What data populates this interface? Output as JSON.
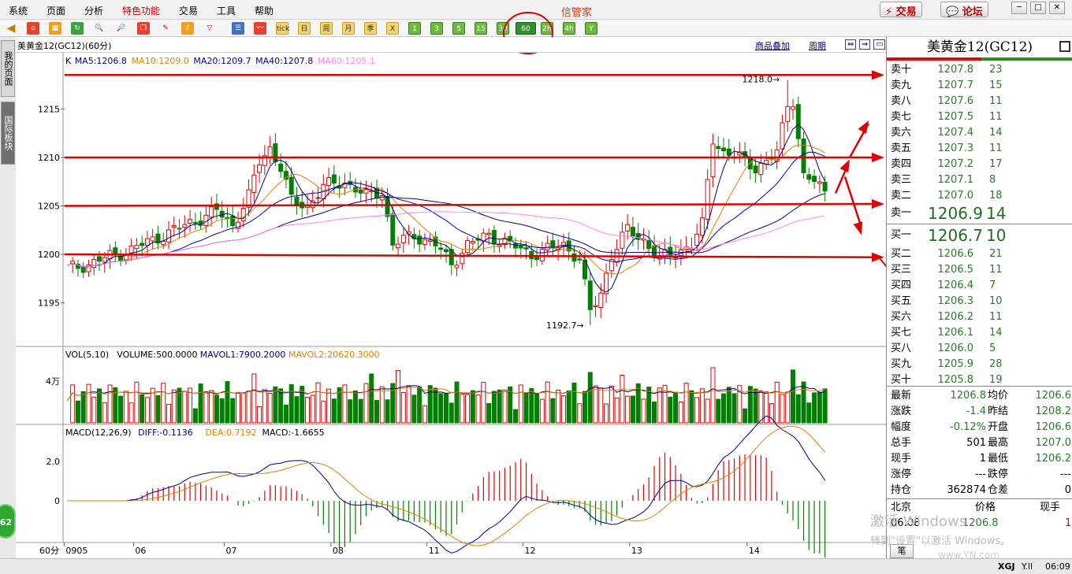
{
  "menubar": {
    "items": [
      "系统",
      "页面",
      "分析",
      "特色功能",
      "交易",
      "工具",
      "帮助"
    ],
    "app_title": "信管家",
    "trade_button": "交易",
    "forum_button": "论坛"
  },
  "toolbar": {
    "periods": [
      "tick",
      "日",
      "周",
      "月",
      "季",
      "X",
      "1",
      "3",
      "5",
      "15",
      "30",
      "60",
      "2h",
      "4h",
      "Y"
    ],
    "selected_period": "60"
  },
  "sidetabs": [
    "我的页面",
    "国际板块"
  ],
  "badge": "62",
  "chart": {
    "symbol_label": "美黄金12(GC12)(60分)",
    "overlay_link": "商品叠加",
    "period_link": "周期",
    "ma_legend": [
      {
        "text": "K",
        "color": "#000000"
      },
      {
        "text": "MA5:1206.8",
        "color": "#000080"
      },
      {
        "text": "MA10:1209.0",
        "color": "#e08000"
      },
      {
        "text": "MA20:1209.7",
        "color": "#0000c0"
      },
      {
        "text": "MA40:1207.8",
        "color": "#000080"
      },
      {
        "text": "MA60:1205.1",
        "color": "#ff80ff"
      }
    ],
    "vol_legend": [
      {
        "text": "VOL(5,10)",
        "color": "#000000"
      },
      {
        "text": "VOLUME:500.0000",
        "color": "#000000"
      },
      {
        "text": "MAVOL1:7900.2000",
        "color": "#000080"
      },
      {
        "text": "MAVOL2:20620.3000",
        "color": "#e08000"
      }
    ],
    "macd_legend": [
      {
        "text": "MACD(12,26,9)",
        "color": "#000000"
      },
      {
        "text": "DIFF:-0.1136",
        "color": "#000080"
      },
      {
        "text": "DEA:0.7192",
        "color": "#e08000"
      },
      {
        "text": "MACD:-1.6655",
        "color": "#000000"
      }
    ],
    "high_label": "1218.0",
    "low_label": "1192.7",
    "vol_axis_label": "4万",
    "period_corner": "60分",
    "colors": {
      "up": "#e00000",
      "down": "#008000",
      "annot": "#e00000"
    }
  },
  "chart_data": [
    {
      "type": "candlestick",
      "title": "美黄金12(GC12)(60分)",
      "y_ticks": [
        1195,
        1200,
        1205,
        1210,
        1215
      ],
      "ylim": [
        1190.5,
        1219.5
      ],
      "x_ticks": [
        "0905",
        "06",
        "07",
        "08",
        "11",
        "12",
        "13",
        "14"
      ],
      "anchors": [
        {
          "x": 0,
          "y": 1198.5
        },
        {
          "x": 4,
          "y": 1199.0
        },
        {
          "x": 8,
          "y": 1199.8
        },
        {
          "x": 12,
          "y": 1200.5
        },
        {
          "x": 16,
          "y": 1201.5
        },
        {
          "x": 20,
          "y": 1202.5
        },
        {
          "x": 24,
          "y": 1203.5
        },
        {
          "x": 28,
          "y": 1204.5
        },
        {
          "x": 31,
          "y": 1203.0
        },
        {
          "x": 34,
          "y": 1206.0
        },
        {
          "x": 36,
          "y": 1209.5
        },
        {
          "x": 38,
          "y": 1211.0
        },
        {
          "x": 40,
          "y": 1209.0
        },
        {
          "x": 42,
          "y": 1205.5
        },
        {
          "x": 45,
          "y": 1205.0
        },
        {
          "x": 48,
          "y": 1207.0
        },
        {
          "x": 52,
          "y": 1207.5
        },
        {
          "x": 56,
          "y": 1206.0
        },
        {
          "x": 59,
          "y": 1206.5
        },
        {
          "x": 61,
          "y": 1201.0
        },
        {
          "x": 65,
          "y": 1202.0
        },
        {
          "x": 69,
          "y": 1201.0
        },
        {
          "x": 72,
          "y": 1199.0
        },
        {
          "x": 75,
          "y": 1201.0
        },
        {
          "x": 79,
          "y": 1202.0
        },
        {
          "x": 83,
          "y": 1201.0
        },
        {
          "x": 87,
          "y": 1200.0
        },
        {
          "x": 90,
          "y": 1200.5
        },
        {
          "x": 93,
          "y": 1201.0
        },
        {
          "x": 96,
          "y": 1199.5
        },
        {
          "x": 98,
          "y": 1194.0
        },
        {
          "x": 100,
          "y": 1196.0
        },
        {
          "x": 102,
          "y": 1200.0
        },
        {
          "x": 105,
          "y": 1202.5
        },
        {
          "x": 108,
          "y": 1201.5
        },
        {
          "x": 111,
          "y": 1199.5
        },
        {
          "x": 115,
          "y": 1200.5
        },
        {
          "x": 117,
          "y": 1201.0
        },
        {
          "x": 119,
          "y": 1203.0
        },
        {
          "x": 121,
          "y": 1212.0
        },
        {
          "x": 123,
          "y": 1210.5
        },
        {
          "x": 126,
          "y": 1210.0
        },
        {
          "x": 129,
          "y": 1209.0
        },
        {
          "x": 131,
          "y": 1209.5
        },
        {
          "x": 133,
          "y": 1210.5
        },
        {
          "x": 135,
          "y": 1215.5
        },
        {
          "x": 136,
          "y": 1216.0
        },
        {
          "x": 138,
          "y": 1208.0
        },
        {
          "x": 140,
          "y": 1207.5
        },
        {
          "x": 142,
          "y": 1206.5
        }
      ],
      "annotations": [
        {
          "text": "1218.0",
          "y": 1218.0,
          "x": 135
        },
        {
          "text": "1192.7",
          "y": 1192.7,
          "x": 98
        }
      ]
    },
    {
      "type": "bar",
      "title": "VOL(5,10)",
      "series": [
        {
          "name": "VOLUME"
        },
        {
          "name": "MAVOL1"
        },
        {
          "name": "MAVOL2"
        }
      ],
      "note_peaks": [
        "4万"
      ]
    },
    {
      "type": "bar",
      "title": "MACD(12,26,9)",
      "y_ticks": [
        0,
        2.0
      ],
      "series": [
        {
          "name": "DIFF"
        },
        {
          "name": "DEA"
        },
        {
          "name": "MACD"
        }
      ]
    }
  ],
  "quote": {
    "title": "美黄金12(GC12)",
    "sell": [
      {
        "label": "卖十",
        "price": "1207.8",
        "vol": "23"
      },
      {
        "label": "卖九",
        "price": "1207.7",
        "vol": "15"
      },
      {
        "label": "卖八",
        "price": "1207.6",
        "vol": "11"
      },
      {
        "label": "卖七",
        "price": "1207.5",
        "vol": "11"
      },
      {
        "label": "卖六",
        "price": "1207.4",
        "vol": "14"
      },
      {
        "label": "卖五",
        "price": "1207.3",
        "vol": "11"
      },
      {
        "label": "卖四",
        "price": "1207.2",
        "vol": "17"
      },
      {
        "label": "卖三",
        "price": "1207.1",
        "vol": "8"
      },
      {
        "label": "卖二",
        "price": "1207.0",
        "vol": "18"
      },
      {
        "label": "卖一",
        "price": "1206.9",
        "vol": "14"
      }
    ],
    "buy": [
      {
        "label": "买一",
        "price": "1206.7",
        "vol": "10"
      },
      {
        "label": "买二",
        "price": "1206.6",
        "vol": "21"
      },
      {
        "label": "买三",
        "price": "1206.5",
        "vol": "11"
      },
      {
        "label": "买四",
        "price": "1206.4",
        "vol": "7"
      },
      {
        "label": "买五",
        "price": "1206.3",
        "vol": "10"
      },
      {
        "label": "买六",
        "price": "1206.2",
        "vol": "11"
      },
      {
        "label": "买七",
        "price": "1206.1",
        "vol": "14"
      },
      {
        "label": "买八",
        "price": "1206.0",
        "vol": "5"
      },
      {
        "label": "买九",
        "price": "1205.9",
        "vol": "28"
      },
      {
        "label": "买十",
        "price": "1205.8",
        "vol": "19"
      }
    ],
    "stats": [
      {
        "k1": "最新",
        "v1": "1206.8",
        "k2": "均价",
        "v2": "1206.6"
      },
      {
        "k1": "涨跌",
        "v1": "-1.4",
        "k2": "昨结",
        "v2": "1208.2"
      },
      {
        "k1": "幅度",
        "v1": "-0.12%",
        "k2": "开盘",
        "v2": "1206.6"
      },
      {
        "k1": "总手",
        "v1": "501",
        "k2": "最高",
        "v2": "1207.0"
      },
      {
        "k1": "现手",
        "v1": "1",
        "k2": "最低",
        "v2": "1206.2"
      },
      {
        "k1": "涨停",
        "v1": "---",
        "k2": "跌停",
        "v2": "---"
      },
      {
        "k1": "持仓",
        "v1": "362874",
        "k2": "仓差",
        "v2": "0"
      }
    ],
    "tick_head": {
      "loc": "北京",
      "price": "价格",
      "vol": "现手"
    },
    "tick_row": {
      "time": "06:08",
      "price": "1206.8",
      "vol": "1"
    },
    "bi_button": "笔"
  },
  "watermark": {
    "line1": "激活 Windows",
    "line2": "转到\"设置\"以激活 Windows。",
    "line3": "www.YN.com"
  },
  "statusbar": {
    "left": "XGJ",
    "mid": "Y.ll",
    "time": "06:09"
  }
}
